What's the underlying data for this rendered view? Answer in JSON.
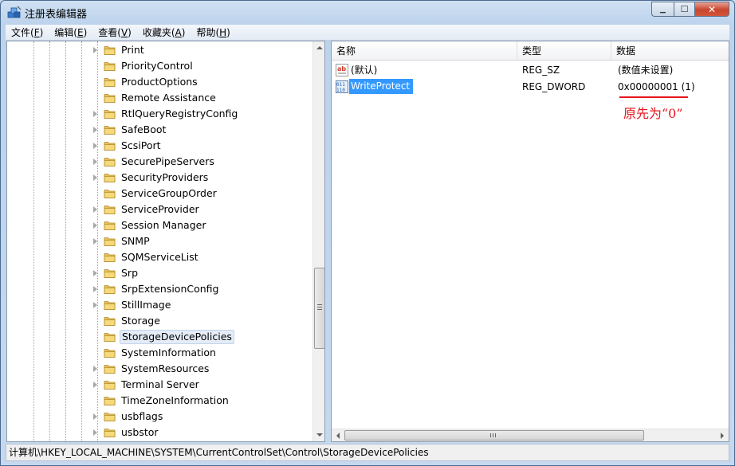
{
  "window": {
    "title": "注册表编辑器",
    "controls": {
      "minimize": "▁",
      "maximize": "☐",
      "close": "✕"
    }
  },
  "menu": [
    {
      "label": "文件",
      "key": "F"
    },
    {
      "label": "编辑",
      "key": "E"
    },
    {
      "label": "查看",
      "key": "V"
    },
    {
      "label": "收藏夹",
      "key": "A"
    },
    {
      "label": "帮助",
      "key": "H"
    }
  ],
  "tree": {
    "selected_index": 18,
    "items": [
      {
        "label": "Print",
        "expandable": true
      },
      {
        "label": "PriorityControl",
        "expandable": false
      },
      {
        "label": "ProductOptions",
        "expandable": false
      },
      {
        "label": "Remote Assistance",
        "expandable": false
      },
      {
        "label": "RtlQueryRegistryConfig",
        "expandable": true
      },
      {
        "label": "SafeBoot",
        "expandable": true
      },
      {
        "label": "ScsiPort",
        "expandable": true
      },
      {
        "label": "SecurePipeServers",
        "expandable": true
      },
      {
        "label": "SecurityProviders",
        "expandable": true
      },
      {
        "label": "ServiceGroupOrder",
        "expandable": false
      },
      {
        "label": "ServiceProvider",
        "expandable": true
      },
      {
        "label": "Session Manager",
        "expandable": true
      },
      {
        "label": "SNMP",
        "expandable": true
      },
      {
        "label": "SQMServiceList",
        "expandable": false
      },
      {
        "label": "Srp",
        "expandable": true
      },
      {
        "label": "SrpExtensionConfig",
        "expandable": true
      },
      {
        "label": "StillImage",
        "expandable": true
      },
      {
        "label": "Storage",
        "expandable": false
      },
      {
        "label": "StorageDevicePolicies",
        "expandable": false
      },
      {
        "label": "SystemInformation",
        "expandable": false
      },
      {
        "label": "SystemResources",
        "expandable": true
      },
      {
        "label": "Terminal Server",
        "expandable": true
      },
      {
        "label": "TimeZoneInformation",
        "expandable": false
      },
      {
        "label": "usbflags",
        "expandable": true
      },
      {
        "label": "usbstor",
        "expandable": true
      }
    ]
  },
  "list": {
    "columns": [
      "名称",
      "类型",
      "数据"
    ],
    "rows": [
      {
        "name": "(默认)",
        "type": "REG_SZ",
        "data": "(数值未设置)",
        "icon": "string-value-icon",
        "selected": false
      },
      {
        "name": "WriteProtect",
        "type": "REG_DWORD",
        "data": "0x00000001 (1)",
        "icon": "dword-value-icon",
        "selected": true
      }
    ]
  },
  "annotation": {
    "text": "原先为“0”",
    "color": "#e8141b"
  },
  "status": {
    "path": "计算机\\HKEY_LOCAL_MACHINE\\SYSTEM\\CurrentControlSet\\Control\\StorageDevicePolicies"
  }
}
